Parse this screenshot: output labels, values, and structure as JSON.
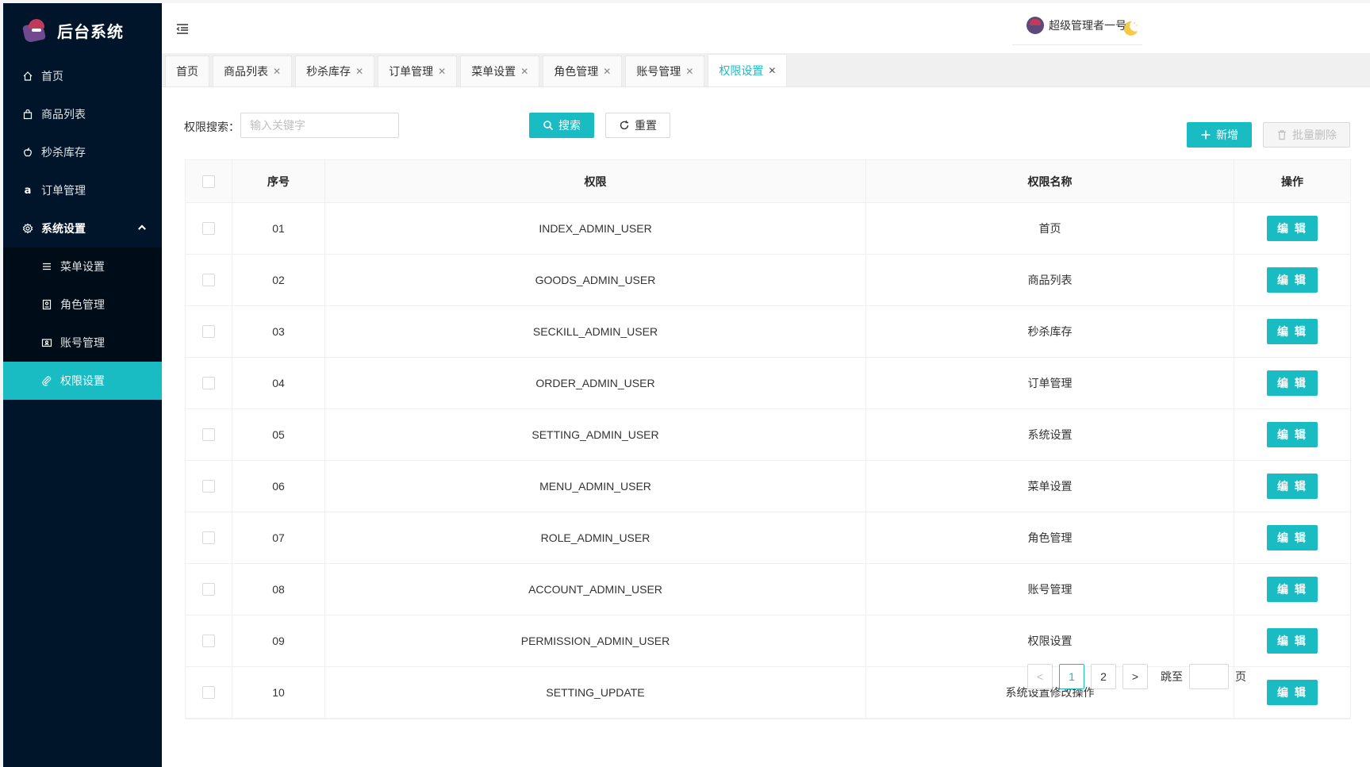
{
  "app": {
    "title": "后台系统"
  },
  "sidebar": {
    "items": [
      {
        "label": "首页",
        "icon": "home-icon"
      },
      {
        "label": "商品列表",
        "icon": "bag-icon"
      },
      {
        "label": "秒杀库存",
        "icon": "apple-icon"
      },
      {
        "label": "订单管理",
        "icon": "amazon-icon"
      },
      {
        "label": "系统设置",
        "icon": "gear-icon"
      }
    ],
    "submenu": [
      {
        "label": "菜单设置",
        "icon": "list-icon"
      },
      {
        "label": "角色管理",
        "icon": "profile-icon"
      },
      {
        "label": "账号管理",
        "icon": "idcard-icon"
      },
      {
        "label": "权限设置",
        "icon": "paperclip-icon"
      }
    ]
  },
  "header": {
    "user_name": "超级管理者一号"
  },
  "tabs": [
    {
      "label": "首页",
      "closable": false
    },
    {
      "label": "商品列表",
      "closable": true
    },
    {
      "label": "秒杀库存",
      "closable": true
    },
    {
      "label": "订单管理",
      "closable": true
    },
    {
      "label": "菜单设置",
      "closable": true
    },
    {
      "label": "角色管理",
      "closable": true
    },
    {
      "label": "账号管理",
      "closable": true
    },
    {
      "label": "权限设置",
      "closable": true,
      "active": true
    }
  ],
  "search": {
    "label": "权限搜索：",
    "placeholder": "输入关键字",
    "search_button": "搜索",
    "reset_button": "重置"
  },
  "actions": {
    "add_button": "新增",
    "batch_delete_button": "批量删除"
  },
  "table": {
    "columns": [
      "序号",
      "权限",
      "权限名称",
      "操作"
    ],
    "edit_label": "编 辑",
    "rows": [
      {
        "no": "01",
        "perm": "INDEX_ADMIN_USER",
        "name": "首页"
      },
      {
        "no": "02",
        "perm": "GOODS_ADMIN_USER",
        "name": "商品列表"
      },
      {
        "no": "03",
        "perm": "SECKILL_ADMIN_USER",
        "name": "秒杀库存"
      },
      {
        "no": "04",
        "perm": "ORDER_ADMIN_USER",
        "name": "订单管理"
      },
      {
        "no": "05",
        "perm": "SETTING_ADMIN_USER",
        "name": "系统设置"
      },
      {
        "no": "06",
        "perm": "MENU_ADMIN_USER",
        "name": "菜单设置"
      },
      {
        "no": "07",
        "perm": "ROLE_ADMIN_USER",
        "name": "角色管理"
      },
      {
        "no": "08",
        "perm": "ACCOUNT_ADMIN_USER",
        "name": "账号管理"
      },
      {
        "no": "09",
        "perm": "PERMISSION_ADMIN_USER",
        "name": "权限设置"
      },
      {
        "no": "10",
        "perm": "SETTING_UPDATE",
        "name": "系统设置修改操作"
      }
    ]
  },
  "pagination": {
    "pages": [
      "1",
      "2"
    ],
    "current": "1",
    "jump_label": "跳至",
    "page_suffix": "页",
    "prev": "<",
    "next": ">"
  },
  "colors": {
    "accent": "#19bcc3",
    "sidebar_bg": "#001529",
    "submenu_bg": "#000c17"
  }
}
